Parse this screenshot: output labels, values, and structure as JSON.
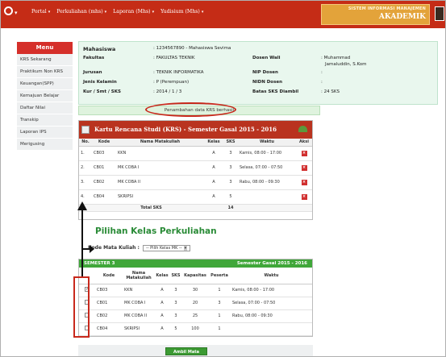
{
  "nav": {
    "logo_caret": "▾",
    "items": [
      {
        "label": "Portal",
        "chev": "▾"
      },
      {
        "label": "Perkuliahan (mhs)",
        "chev": "▾"
      },
      {
        "label": "Laporan (Mhs)",
        "chev": "▾"
      },
      {
        "label": "Yudisium (Mhs)",
        "chev": "▾"
      }
    ],
    "brand_line1": "SISTEM INFORMASI MANAJEMEN",
    "brand_line2": "AKADEMIK"
  },
  "sidebar": {
    "title": "Menu",
    "items": [
      "KRS Sekarang",
      "Praktikum Non KRS",
      "Keuangan(SPP)",
      "Kemajuan Belajar",
      "Daftar Nilai",
      "Transkip",
      "Laporan IPS",
      "Merigusing"
    ]
  },
  "student": {
    "name_label": "Mahasiswa",
    "name_value": ": 1234567890 - Mahasiswa Sevima",
    "fakultas_label": "Fakultas",
    "fakultas_value": ": FAKULTAS TEKNIK",
    "dosen_label": "Dosen Wali",
    "dosen_value": ": Muhammad",
    "dosen_value2": "Jamaluddin, S.Kom",
    "jurusan_label": "Jurusan",
    "jurusan_value": ": TEKNIK INFORMATIKA",
    "nip_label": "NIP Dosen",
    "nip_value": ":",
    "jk_label": "Jenis Kelamin",
    "jk_value": ": P (Perempuan)",
    "nidn_label": "NIDN Dosen",
    "nidn_value": ":",
    "kur_label": "Kur / Smt / SKS",
    "kur_value": ": 2014 / 1 / 3",
    "batas_label": "Batas SKS Diambil",
    "batas_value": ": 24 SKS"
  },
  "notice": "Penambahan data KRS berhasil",
  "krs": {
    "title": "Kartu Rencana Studi (KRS) - Semester Gasal 2015 - 2016",
    "headers": [
      "No.",
      "Kode",
      "Nama Matakuliah",
      "Kelas",
      "SKS",
      "Waktu",
      "Aksi"
    ],
    "rows": [
      {
        "no": "1.",
        "kode": "CB03",
        "nama": "KKN",
        "kelas": "A",
        "sks": "3",
        "waktu": "Kamis, 08:00 - 17:00"
      },
      {
        "no": "2.",
        "kode": "CB01",
        "nama": "MK COBA I",
        "kelas": "A",
        "sks": "3",
        "waktu": "Selasa, 07:00 - 07:50"
      },
      {
        "no": "3.",
        "kode": "CB02",
        "nama": "MK COBA II",
        "kelas": "A",
        "sks": "3",
        "waktu": "Rabu, 08:00 - 09:30"
      },
      {
        "no": "4.",
        "kode": "CB04",
        "nama": "SKRIPSI",
        "kelas": "A",
        "sks": "5",
        "waktu": ""
      }
    ],
    "delete_glyph": "×",
    "total_label": "Total SKS",
    "total_value": "14"
  },
  "pilihan": {
    "title": "Pilihan Kelas Perkuliahan",
    "filter_label": "Kode Mata Kuliah :",
    "filter_value": "-- Pilih Kelas MK --",
    "filter_dd": "▾",
    "semester_left": "SEMESTER 3",
    "semester_right": "Semester Gasal 2015 - 2016",
    "headers": [
      "",
      "Kode",
      "Nama Matakuliah",
      "Kelas",
      "SKS",
      "Kapasitas",
      "Peserta",
      "Waktu"
    ],
    "rows": [
      {
        "checked": true,
        "kode": "CB03",
        "nama": "KKN",
        "kelas": "A",
        "sks": "3",
        "kap": "30",
        "peserta": "1",
        "waktu": "Kamis, 08:00 - 17:00"
      },
      {
        "checked": false,
        "kode": "CB01",
        "nama": "MK COBA I",
        "kelas": "A",
        "sks": "3",
        "kap": "20",
        "peserta": "3",
        "waktu": "Selasa, 07:00 - 07:50"
      },
      {
        "checked": false,
        "kode": "CB02",
        "nama": "MK COBA II",
        "kelas": "A",
        "sks": "3",
        "kap": "25",
        "peserta": "1",
        "waktu": "Rabu, 08:00 - 09:30"
      },
      {
        "checked": false,
        "kode": "CB04",
        "nama": "SKRIPSI",
        "kelas": "A",
        "sks": "5",
        "kap": "100",
        "peserta": "1",
        "waktu": ""
      }
    ],
    "submit_label": "Ambil Mata Kuliah"
  }
}
